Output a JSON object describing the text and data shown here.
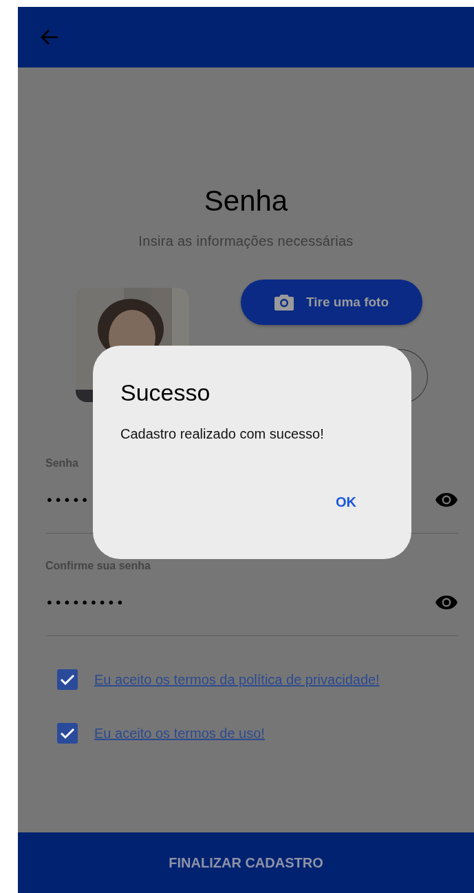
{
  "header": {
    "title": "Senha",
    "subtitle": "Insira as informações necessárias"
  },
  "camera_button": {
    "label": "Tire uma foto"
  },
  "fields": [
    {
      "label": "Senha",
      "value": "•••••"
    },
    {
      "label": "Confirme sua senha",
      "value": "•••••••••"
    }
  ],
  "agreements": [
    {
      "label": "Eu aceito os termos da política de privacidade!",
      "checked": true
    },
    {
      "label": "Eu aceito os termos de uso!",
      "checked": true
    }
  ],
  "submit": {
    "label": "FINALIZAR CADASTRO"
  },
  "dialog": {
    "title": "Sucesso",
    "message": "Cadastro realizado com sucesso!",
    "button": "OK"
  }
}
